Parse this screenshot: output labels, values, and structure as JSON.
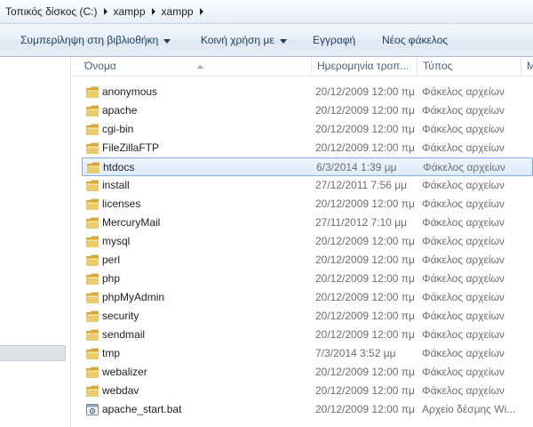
{
  "address": {
    "crumbs": [
      "Τοπικός δίσκος (C:)",
      "xampp",
      "xampp"
    ]
  },
  "commands": {
    "include_in_library": "Συμπερίληψη στη βιβλιοθήκη",
    "share_with": "Κοινή χρήση με",
    "burn": "Εγγραφή",
    "new_folder": "Νέος φάκελος"
  },
  "columns": {
    "name": "Όνομα",
    "date": "Ημερομηνία τροπ...",
    "type": "Τύπος",
    "size": "Μ"
  },
  "files": [
    {
      "name": "anonymous",
      "date": "20/12/2009 12:00 πμ",
      "type": "Φάκελος αρχείων",
      "icon": "folder-icon"
    },
    {
      "name": "apache",
      "date": "20/12/2009 12:00 πμ",
      "type": "Φάκελος αρχείων",
      "icon": "folder-icon"
    },
    {
      "name": "cgi-bin",
      "date": "20/12/2009 12:00 πμ",
      "type": "Φάκελος αρχείων",
      "icon": "folder-icon"
    },
    {
      "name": "FileZillaFTP",
      "date": "20/12/2009 12:00 πμ",
      "type": "Φάκελος αρχείων",
      "icon": "folder-icon"
    },
    {
      "name": "htdocs",
      "date": "6/3/2014 1:39 μμ",
      "type": "Φάκελος αρχείων",
      "icon": "folder-icon",
      "selected": true
    },
    {
      "name": "install",
      "date": "27/12/2011 7:56 μμ",
      "type": "Φάκελος αρχείων",
      "icon": "folder-icon"
    },
    {
      "name": "licenses",
      "date": "20/12/2009 12:00 πμ",
      "type": "Φάκελος αρχείων",
      "icon": "folder-icon"
    },
    {
      "name": "MercuryMail",
      "date": "27/11/2012 7:10 μμ",
      "type": "Φάκελος αρχείων",
      "icon": "folder-icon"
    },
    {
      "name": "mysql",
      "date": "20/12/2009 12:00 πμ",
      "type": "Φάκελος αρχείων",
      "icon": "folder-icon"
    },
    {
      "name": "perl",
      "date": "20/12/2009 12:00 πμ",
      "type": "Φάκελος αρχείων",
      "icon": "folder-icon"
    },
    {
      "name": "php",
      "date": "20/12/2009 12:00 πμ",
      "type": "Φάκελος αρχείων",
      "icon": "folder-icon"
    },
    {
      "name": "phpMyAdmin",
      "date": "20/12/2009 12:00 πμ",
      "type": "Φάκελος αρχείων",
      "icon": "folder-icon"
    },
    {
      "name": "security",
      "date": "20/12/2009 12:00 πμ",
      "type": "Φάκελος αρχείων",
      "icon": "folder-icon"
    },
    {
      "name": "sendmail",
      "date": "20/12/2009 12:00 πμ",
      "type": "Φάκελος αρχείων",
      "icon": "folder-icon"
    },
    {
      "name": "tmp",
      "date": "7/3/2014 3:52 μμ",
      "type": "Φάκελος αρχείων",
      "icon": "folder-icon"
    },
    {
      "name": "webalizer",
      "date": "20/12/2009 12:00 πμ",
      "type": "Φάκελος αρχείων",
      "icon": "folder-icon"
    },
    {
      "name": "webdav",
      "date": "20/12/2009 12:00 πμ",
      "type": "Φάκελος αρχείων",
      "icon": "folder-icon"
    },
    {
      "name": "apache_start.bat",
      "date": "20/12/2009 12:00 πμ",
      "type": "Αρχείο δέσμης Wi...",
      "icon": "batch-file-icon"
    }
  ],
  "colors": {
    "selection_border": "#84acdd",
    "selection_fill": "#dcebfc",
    "folder_yellow": "#e8c15a",
    "command_text": "#1e3d5c",
    "header_text": "#4c607a",
    "secondary_text": "#6d6d6d"
  }
}
